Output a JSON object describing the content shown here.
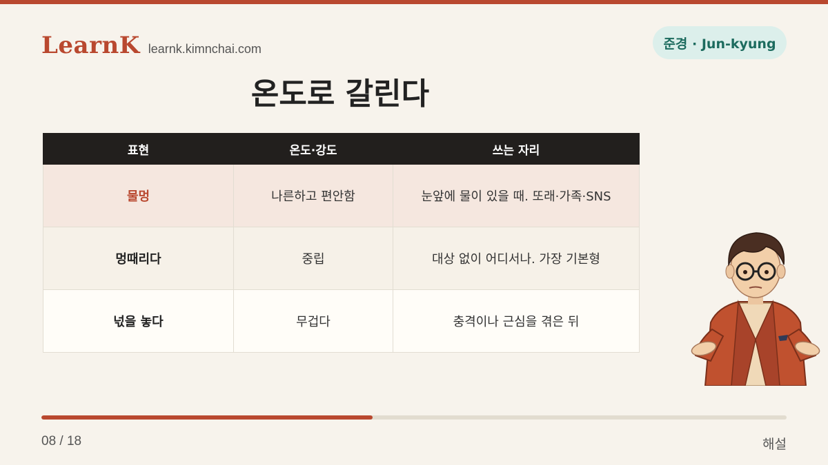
{
  "brand": {
    "logo": "LearnK",
    "url": "learnk.kimnchai.com"
  },
  "speaker": "준경 · Jun-kyung",
  "title": "온도로 갈린다",
  "table": {
    "headers": [
      "표현",
      "온도·강도",
      "쓰는 자리"
    ],
    "rows": [
      {
        "expression": "물멍",
        "temperature": "나른하고 편안함",
        "usage": "눈앞에 물이 있을 때. 또래·가족·SNS"
      },
      {
        "expression": "멍때리다",
        "temperature": "중립",
        "usage": "대상 없이 어디서나. 가장 기본형"
      },
      {
        "expression": "넋을 놓다",
        "temperature": "무겁다",
        "usage": "충격이나 근심을 겪은 뒤"
      }
    ]
  },
  "footer": {
    "page_counter": "08 / 18",
    "section": "해설",
    "progress": 0.444
  },
  "colors": {
    "accent": "#b9482f",
    "badge_bg": "#dcefeb",
    "badge_text": "#1c6b5e",
    "header_bg": "#221f1d"
  },
  "icons": {
    "character": "shrugging-man-with-glasses-illustration"
  }
}
